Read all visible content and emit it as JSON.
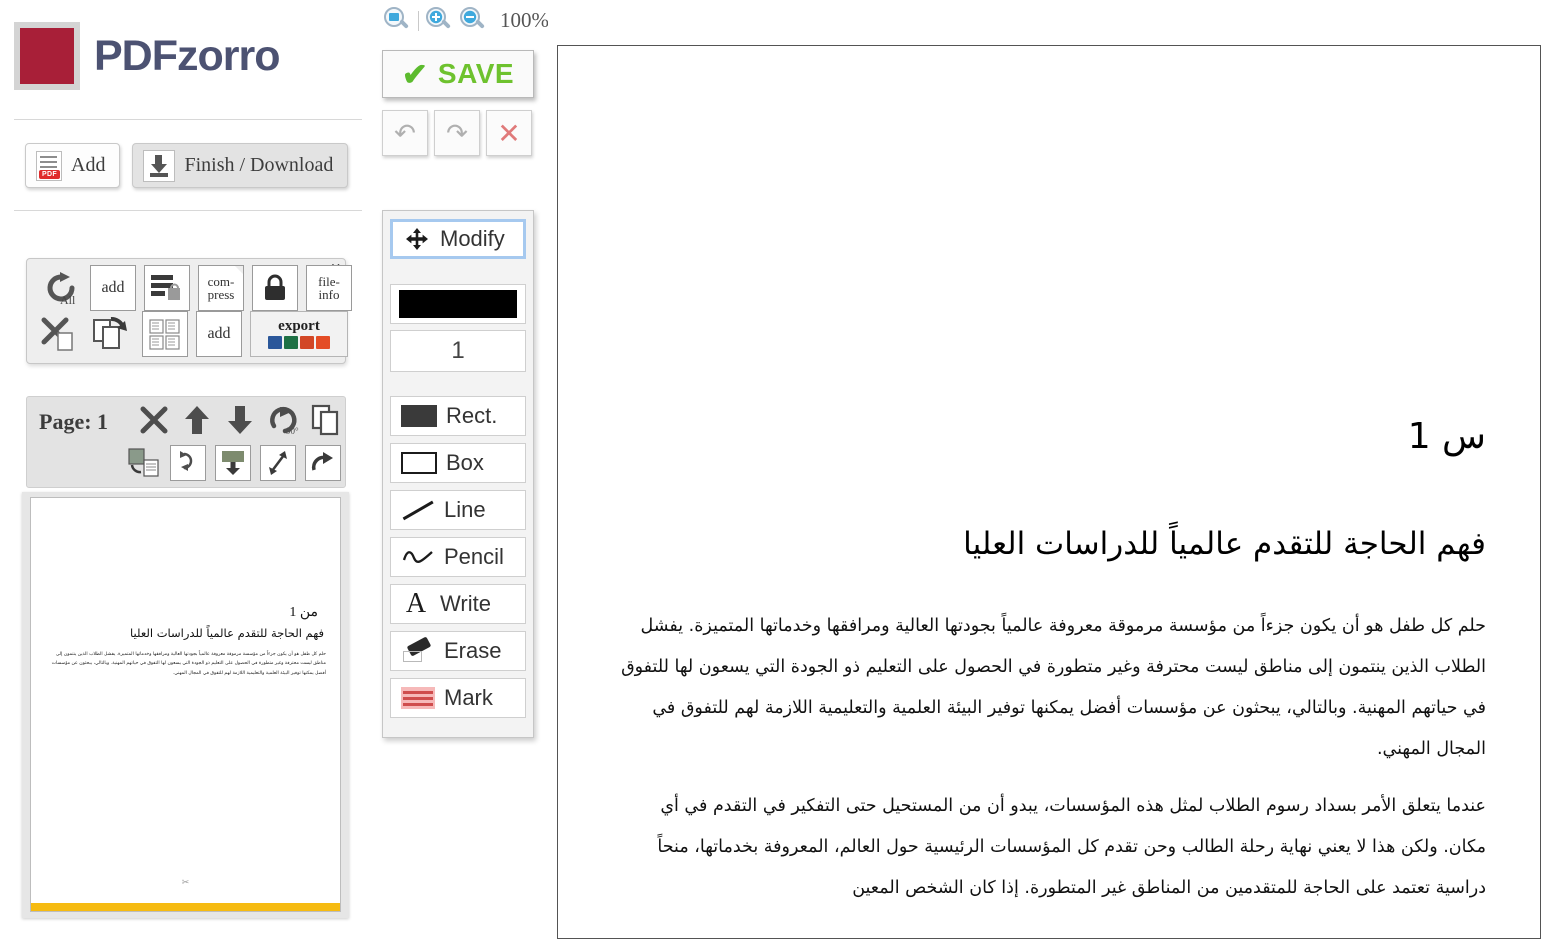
{
  "brand": {
    "name": "PDFzorro",
    "mark_color": "#a81f38",
    "mark_frame_color": "#d4d4d4",
    "text_color": "#4c5272"
  },
  "file_actions": [
    {
      "label": "Add",
      "icon": "pdf-document-icon",
      "badge": "PDF"
    },
    {
      "label": "Finish / Download",
      "icon": "download-icon"
    }
  ],
  "icon_panel": {
    "close_label": "X",
    "row1": [
      {
        "name": "rotate-all-icon",
        "label": "All"
      },
      {
        "name": "add-page-icon",
        "label": "add"
      },
      {
        "name": "merge-documents-icon",
        "label": ""
      },
      {
        "name": "compress-icon",
        "label": "com-\npress",
        "line1": "com-",
        "line2": "press"
      },
      {
        "name": "protect-lock-icon",
        "label": ""
      },
      {
        "name": "file-info-icon",
        "line1": "file-",
        "line2": "info"
      }
    ],
    "row2": [
      {
        "name": "delete-pages-icon",
        "label": ""
      },
      {
        "name": "duplicate-rotate-icon",
        "label": ""
      },
      {
        "name": "split-pages-icon",
        "label": ""
      },
      {
        "name": "add-text-page-icon",
        "label": "add"
      },
      {
        "name": "export-icon",
        "label": "export",
        "formats": [
          "word",
          "excel",
          "powerpoint",
          "html5"
        ]
      }
    ]
  },
  "page_toolbar": {
    "page_label": "Page: 1",
    "row1": [
      {
        "name": "delete-page-icon",
        "glyph": "✕"
      },
      {
        "name": "move-page-up-icon",
        "glyph": "⬆"
      },
      {
        "name": "move-page-down-icon",
        "glyph": "⬇"
      },
      {
        "name": "rotate-page-90-icon",
        "glyph": "↻",
        "sub": "90°"
      },
      {
        "name": "duplicate-page-icon",
        "glyph": "⧉"
      }
    ],
    "row2": [
      {
        "name": "extract-text-icon"
      },
      {
        "name": "reorder-page-icon"
      },
      {
        "name": "download-page-icon"
      },
      {
        "name": "resize-page-icon"
      },
      {
        "name": "share-page-icon"
      }
    ]
  },
  "thumbnail": {
    "page_number_text": "من 1",
    "title": "فهم الحاجة للتقدم عالمياً للدراسات العليا",
    "body": "حلم كل طفل هو أن يكون جزءاً من مؤسسة مرموقة معروفة عالمياً بجودتها العالية ومرافقها وخدماتها المتميزة. يفشل الطلاب الذين ينتمون إلى مناطق ليست محترفة وغير متطورة في الحصول على التعليم ذو الجودة التي يسعون لها التفوق في حياتهم المهنية. وبالتالي، يبحثون عن مؤسسات أفضل يمكنها توفير البيئة العلمية والتعليمية اللازمة لهم للتفوق في المجال المهني.",
    "cursor_mark": "✂",
    "accent_bar_color": "#f6bb11"
  },
  "zoom_controls": {
    "fit_page_icon": "fit-page-zoom-icon",
    "zoom_in_icon": "zoom-in-icon",
    "zoom_out_icon": "zoom-out-icon",
    "level": "100%"
  },
  "save_button": {
    "label": "SAVE",
    "check_glyph": "✔",
    "color": "#6ec22e"
  },
  "history_buttons": [
    {
      "name": "undo-button",
      "glyph": "↶"
    },
    {
      "name": "redo-button",
      "glyph": "↷"
    },
    {
      "name": "cancel-button",
      "glyph": "✕"
    }
  ],
  "tools": {
    "selected": "Modify",
    "modify": {
      "label": "Modify",
      "icon": "move-arrows-icon"
    },
    "color_swatch": {
      "name": "color-swatch",
      "color": "#000000"
    },
    "thickness": {
      "name": "thickness-input",
      "value": "1"
    },
    "items": [
      {
        "label": "Rect.",
        "icon": "filled-rectangle-icon"
      },
      {
        "label": "Box",
        "icon": "outlined-rectangle-icon"
      },
      {
        "label": "Line",
        "icon": "diagonal-line-icon"
      },
      {
        "label": "Pencil",
        "icon": "pencil-squiggle-icon"
      },
      {
        "label": "Write",
        "icon": "text-letter-a-icon"
      },
      {
        "label": "Erase",
        "icon": "eraser-icon"
      },
      {
        "label": "Mark",
        "icon": "highlighter-lines-icon"
      }
    ]
  },
  "document_page": {
    "page_number_text": "س 1",
    "title": "فهم الحاجة للتقدم عالمياً للدراسات العليا",
    "paragraph_1": "حلم كل طفل هو أن يكون جزءاً من مؤسسة مرموقة معروفة عالمياً بجودتها العالية ومرافقها وخدماتها المتميزة. يفشل الطلاب الذين ينتمون إلى مناطق ليست محترفة وغير متطورة في الحصول على التعليم ذو الجودة التي يسعون لها للتفوق في حياتهم المهنية. وبالتالي، يبحثون عن مؤسسات أفضل يمكنها توفير البيئة العلمية والتعليمية اللازمة لهم للتفوق في المجال المهني.",
    "paragraph_2": "عندما يتعلق الأمر بسداد رسوم الطلاب لمثل هذه المؤسسات، يبدو أن من المستحيل حتى التفكير في التقدم في أي مكان. ولكن هذا لا يعني نهاية رحلة الطالب وحن تقدم كل المؤسسات الرئيسية حول العالم، المعروفة بخدماتها، منحاً دراسية تعتمد على الحاجة للمتقدمين من المناطق غير المتطورة. إذا كان الشخص المعين"
  }
}
